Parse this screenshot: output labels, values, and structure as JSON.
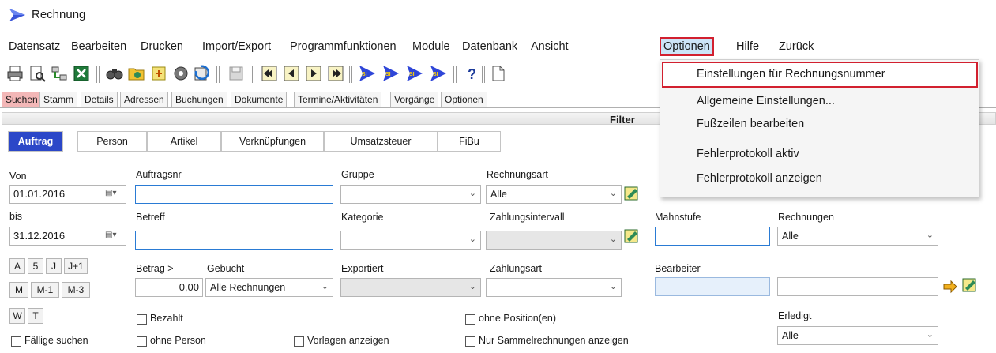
{
  "window": {
    "title": "Rechnung"
  },
  "menu": [
    "Datensatz",
    "Bearbeiten",
    "Drucken",
    "Import/Export",
    "Programmfunktionen",
    "Module",
    "Datenbank",
    "Ansicht",
    "Optionen",
    "Hilfe",
    "Zurück"
  ],
  "toolbar_icons": [
    "printer-icon",
    "print-preview-icon",
    "network-icon",
    "excel-icon",
    "find-icon",
    "open-folder-icon",
    "export-icon",
    "settings-gear-icon",
    "refresh-icon",
    "save-icon",
    "first-record-icon",
    "previous-record-icon",
    "next-record-icon",
    "last-record-icon",
    "si-1-icon",
    "si-2-icon",
    "si-3-icon",
    "si-4-icon",
    "help-icon",
    "new-document-icon"
  ],
  "main_tabs": [
    "Suchen",
    "Stamm",
    "Details",
    "Adressen",
    "Buchungen",
    "Dokumente",
    "Termine/Aktivitäten",
    "Vorgänge",
    "Optionen"
  ],
  "filter_label": "Filter",
  "sub_tabs": [
    "Auftrag",
    "Person",
    "Artikel",
    "Verknüpfungen",
    "Umsatzsteuer",
    "FiBu"
  ],
  "form": {
    "von_label": "Von",
    "von_value": "01.01.2016",
    "bis_label": "bis",
    "bis_value": "31.12.2016",
    "auftragsnr_label": "Auftragsnr",
    "auftragsnr_value": "",
    "betreff_label": "Betreff",
    "betreff_value": "",
    "gruppe_label": "Gruppe",
    "gruppe_value": "",
    "kategorie_label": "Kategorie",
    "kategorie_value": "",
    "exportiert_label": "Exportiert",
    "exportiert_value": "",
    "rechnungsart_label": "Rechnungsart",
    "rechnungsart_value": "Alle",
    "zahlungsintervall_label": "Zahlungsintervall",
    "zahlungsintervall_value": "",
    "zahlungsart_label": "Zahlungsart",
    "zahlungsart_value": "",
    "mahnstufe_label": "Mahnstufe",
    "mahnstufe_value": "",
    "rechnungen_label": "Rechnungen",
    "rechnungen_value": "Alle",
    "bearbeiter_label": "Bearbeiter",
    "bearbeiter_value": "",
    "bearbeiter_name": "",
    "erledigt_label": "Erledigt",
    "erledigt_value": "Alle",
    "betrag_label": "Betrag >",
    "betrag_value": "0,00",
    "gebucht_label": "Gebucht",
    "gebucht_value": "Alle Rechnungen",
    "quick_buttons_row1": [
      "A",
      "5",
      "J",
      "J+1"
    ],
    "quick_buttons_row2": [
      "M",
      "M-1",
      "M-3"
    ],
    "quick_buttons_row3": [
      "W",
      "T"
    ],
    "chk_faellige": "Fällige suchen",
    "chk_bezahlt": "Bezahlt",
    "chk_ohne_person": "ohne Person",
    "chk_vorlagen": "Vorlagen anzeigen",
    "chk_ohne_position": "ohne Position(en)",
    "chk_sammelrechnungen": "Nur Sammelrechnungen anzeigen"
  },
  "dropdown": {
    "items": [
      "Einstellungen für Rechnungsnummer",
      "Allgemeine Einstellungen...",
      "Fußzeilen bearbeiten",
      "Fehlerprotokoll aktiv",
      "Fehlerprotokoll anzeigen"
    ]
  },
  "colors": {
    "highlight_red": "#d2202f",
    "selected_tab_blue": "#2b47c8",
    "selected_main_tab": "#f3b7b7"
  }
}
